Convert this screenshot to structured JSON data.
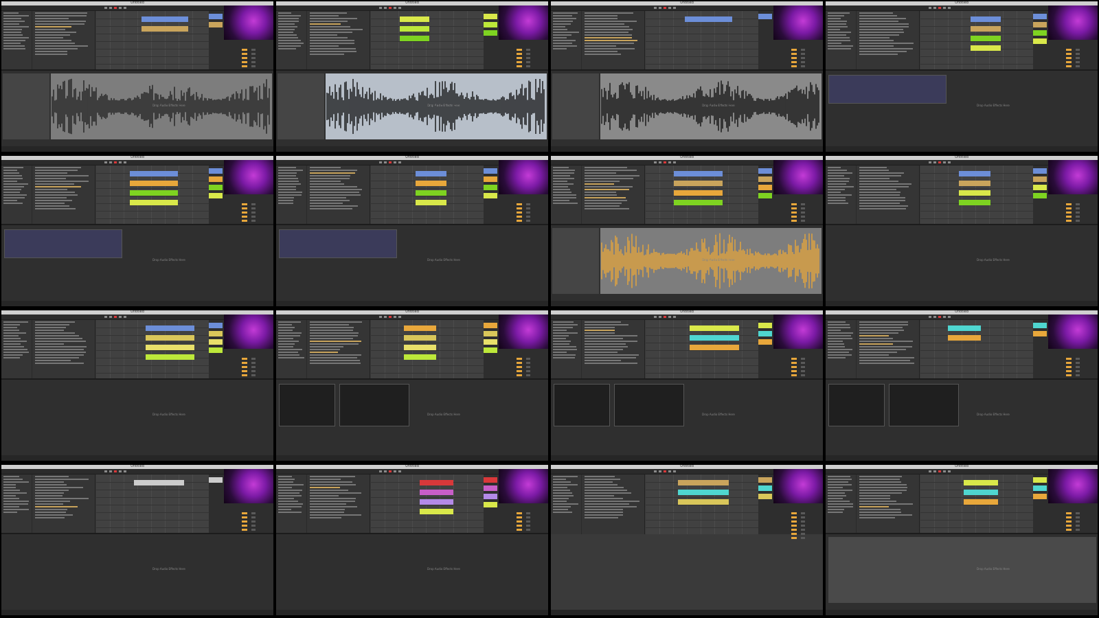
{
  "app": {
    "title": "Untitled",
    "status_text": "Drop Audio Effects Here"
  },
  "colors": {
    "orange": "#e8a73b",
    "yellow": "#d9e84a",
    "green": "#7ed321",
    "blue": "#6c8ed8",
    "cyan": "#4fd6d0",
    "red": "#d9383a",
    "pink": "#c85ec8",
    "purple": "#b48ae8",
    "tan": "#c9a45c",
    "lime": "#bde83a"
  },
  "icons": [
    "play-icon",
    "stop-icon",
    "record-icon",
    "metronome-icon",
    "loop-icon"
  ],
  "panels": [
    {
      "id": 1,
      "detail": "wave",
      "wave_color": "#222222",
      "wave_bg": "#7d7d7d",
      "clips": [
        "#6c8ed8",
        "#c9a45c"
      ]
    },
    {
      "id": 2,
      "detail": "wave",
      "wave_color": "#111111",
      "wave_bg": "#b7bfc9",
      "clips": [
        "#d9e84a",
        "#bde83a",
        "#7ed321"
      ]
    },
    {
      "id": 3,
      "detail": "wave",
      "wave_color": "#111111",
      "wave_bg": "#8a8a8a",
      "clips": [
        "#6c8ed8"
      ]
    },
    {
      "id": 4,
      "detail": "device",
      "clips": [
        "#6c8ed8",
        "#c9a45c",
        "#7ed321",
        "#d9e84a"
      ]
    },
    {
      "id": 5,
      "detail": "device",
      "clips": [
        "#6c8ed8",
        "#e8a73b",
        "#7ed321",
        "#d9e84a"
      ]
    },
    {
      "id": 6,
      "detail": "device",
      "clips": [
        "#6c8ed8",
        "#e8a73b",
        "#7ed321",
        "#d9e84a"
      ]
    },
    {
      "id": 7,
      "detail": "orange-wave",
      "clips": [
        "#6c8ed8",
        "#c9a45c",
        "#e8a73b",
        "#7ed321"
      ]
    },
    {
      "id": 8,
      "detail": "empty",
      "clips": [
        "#6c8ed8",
        "#c9a45c",
        "#d9e84a",
        "#7ed321"
      ]
    },
    {
      "id": 9,
      "detail": "empty",
      "clips": [
        "#6c8ed8",
        "#d9c65a",
        "#e8e06a",
        "#bde83a"
      ]
    },
    {
      "id": 10,
      "detail": "eq",
      "clips": [
        "#e8a73b",
        "#d9c65a",
        "#e8e06a",
        "#bde83a"
      ]
    },
    {
      "id": 11,
      "detail": "eq",
      "clips": [
        "#d9e84a",
        "#4fd6d0",
        "#e8a73b"
      ]
    },
    {
      "id": 12,
      "detail": "eq",
      "clips": [
        "#4fd6d0",
        "#e8a73b"
      ]
    },
    {
      "id": 13,
      "detail": "empty",
      "clips": [
        "#cccccc"
      ]
    },
    {
      "id": 14,
      "detail": "empty",
      "clips": [
        "#d9383a",
        "#c85ec8",
        "#b48ae8",
        "#d9e84a"
      ]
    },
    {
      "id": 15,
      "detail": "none",
      "clips": [
        "#c9a45c",
        "#4fd6d0",
        "#d9c65a"
      ]
    },
    {
      "id": 16,
      "detail": "drums",
      "clips": [
        "#d9e84a",
        "#4fd6d0",
        "#e8a73b"
      ]
    }
  ]
}
